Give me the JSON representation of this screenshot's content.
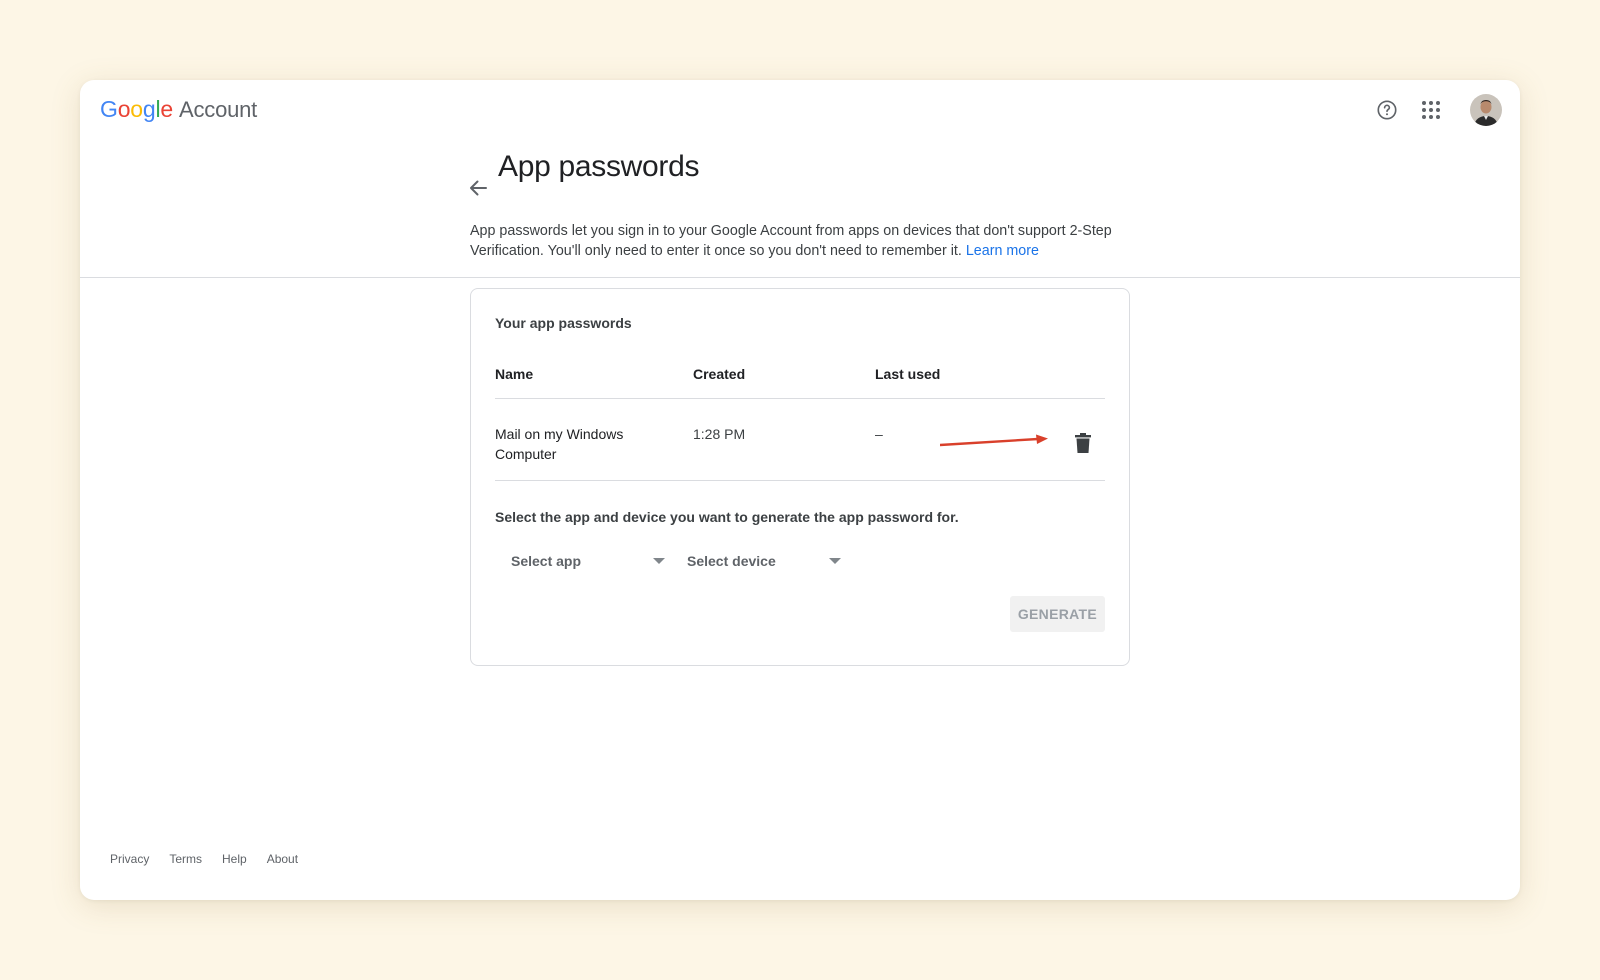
{
  "app": {
    "logo_google": [
      "G",
      "o",
      "o",
      "g",
      "l",
      "e"
    ],
    "logo_colors": [
      "#4285F4",
      "#EA4335",
      "#FBBC05",
      "#4285F4",
      "#34A853",
      "#EA4335"
    ],
    "logo_account": "Account"
  },
  "header": {
    "title": "App passwords",
    "icons": [
      "help-icon",
      "apps-grid-icon",
      "avatar"
    ]
  },
  "description": {
    "text": "App passwords let you sign in to your Google Account from apps on devices that don't support 2-Step Verification. You'll only need to enter it once so you don't need to remember it.",
    "link": "Learn more"
  },
  "card": {
    "title": "Your app passwords",
    "columns": {
      "name": "Name",
      "created": "Created",
      "last_used": "Last used"
    },
    "rows": [
      {
        "name": "Mail on my Windows Computer",
        "created": "1:28 PM",
        "last_used": "–"
      }
    ],
    "select_label": "Select the app and device you want to generate the app password for.",
    "select_app": "Select app",
    "select_device": "Select device",
    "generate": "GENERATE"
  },
  "footer": {
    "links": [
      "Privacy",
      "Terms",
      "Help",
      "About"
    ]
  },
  "colors": {
    "accent": "#1a73e8",
    "annotation_arrow": "#d9402b",
    "background": "#fdf6e6"
  }
}
